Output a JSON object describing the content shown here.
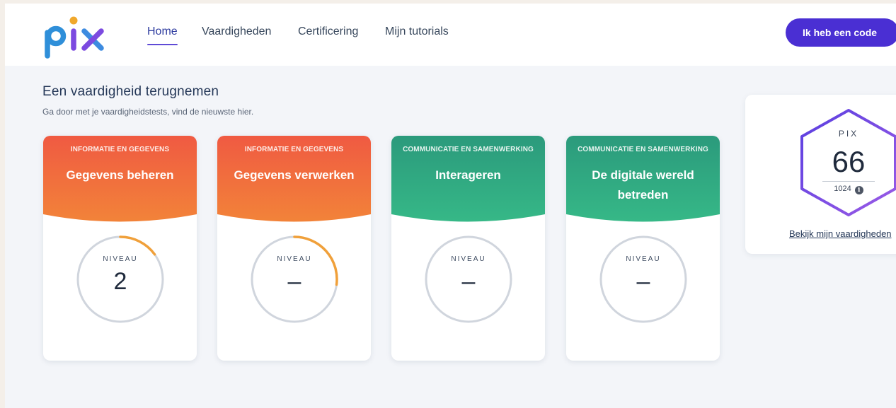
{
  "brand": {
    "logo_text": "pix",
    "logo_colors": [
      "#2f8fd9",
      "#7c4ae0",
      "#f0a82c"
    ]
  },
  "nav": {
    "items": [
      {
        "label": "Home",
        "active": true
      },
      {
        "label": "Vaardigheden",
        "active": false
      },
      {
        "label": "Certificering",
        "active": false
      },
      {
        "label": "Mijn tutorials",
        "active": false
      }
    ],
    "code_button": "Ik heb een code"
  },
  "section": {
    "title": "Een vaardigheid terugnemen",
    "subtitle": "Ga door met je vaardigheidstests, vind de nieuwste hier."
  },
  "cards": [
    {
      "area": "INFORMATIE EN GEGEVENS",
      "name": "Gegevens beheren",
      "level_label": "NIVEAU",
      "level": "2",
      "progress": 0.15,
      "theme": "orange"
    },
    {
      "area": "INFORMATIE EN GEGEVENS",
      "name": "Gegevens verwerken",
      "level_label": "NIVEAU",
      "level": "–",
      "progress": 0.27,
      "theme": "orange"
    },
    {
      "area": "COMMUNICATIE EN SAMENWERKING",
      "name": "Interageren",
      "level_label": "NIVEAU",
      "level": "–",
      "progress": 0,
      "theme": "green"
    },
    {
      "area": "COMMUNICATIE EN SAMENWERKING",
      "name": "De digitale wereld betreden",
      "level_label": "NIVEAU",
      "level": "–",
      "progress": 0,
      "theme": "green"
    }
  ],
  "themes": {
    "orange": {
      "top": "#f05a42",
      "bottom": "#f28339"
    },
    "green": {
      "top": "#2b9a7c",
      "bottom": "#36b887"
    }
  },
  "gauge_colors": {
    "track": "#d0d5dd",
    "fill": "#f0a03a"
  },
  "score": {
    "label": "PIX",
    "value": "66",
    "max": "1024",
    "link": "Bekijk mijn vaardigheden",
    "hex_gradient": [
      "#5a3fe0",
      "#9b5be6"
    ]
  }
}
